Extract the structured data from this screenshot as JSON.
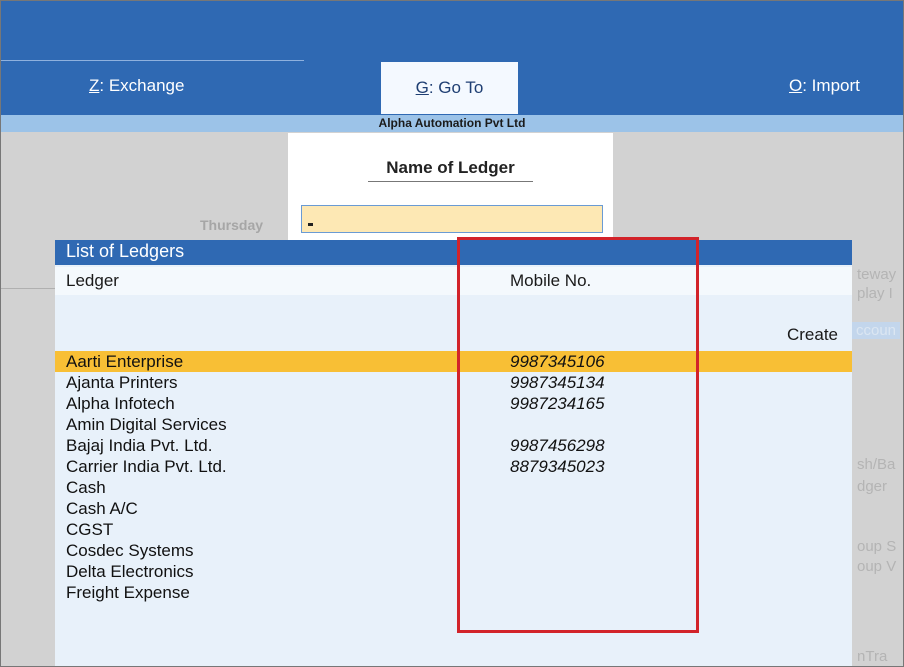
{
  "menu": {
    "exchange": {
      "key": "Z",
      "label": ": Exchange"
    },
    "goto": {
      "key": "G",
      "label": ": Go To"
    },
    "import": {
      "key": "O",
      "label": ": Import"
    }
  },
  "company": "Alpha Automation Pvt Ltd",
  "name_box": {
    "title": "Name of Ledger",
    "value": ""
  },
  "background": {
    "day": "Thursday",
    "ghost_right": [
      "teway",
      "play I",
      "ccoun",
      "sh/Ba",
      "dger",
      "oup S",
      "oup V",
      "nTra"
    ]
  },
  "list": {
    "title": "List of Ledgers",
    "columns": [
      "Ledger",
      "Mobile No."
    ],
    "create_label": "Create",
    "rows": [
      {
        "name": "Aarti Enterprise",
        "mobile": "9987345106",
        "selected": true
      },
      {
        "name": "Ajanta Printers",
        "mobile": "9987345134"
      },
      {
        "name": "Alpha Infotech",
        "mobile": "9987234165"
      },
      {
        "name": "Amin Digital Services",
        "mobile": ""
      },
      {
        "name": "Bajaj India Pvt. Ltd.",
        "mobile": "9987456298"
      },
      {
        "name": "Carrier India Pvt. Ltd.",
        "mobile": "8879345023"
      },
      {
        "name": "Cash",
        "mobile": ""
      },
      {
        "name": "Cash A/C",
        "mobile": ""
      },
      {
        "name": "CGST",
        "mobile": ""
      },
      {
        "name": "Cosdec Systems",
        "mobile": ""
      },
      {
        "name": "Delta Electronics",
        "mobile": ""
      },
      {
        "name": "Freight Expense",
        "mobile": ""
      }
    ]
  },
  "colors": {
    "topbar": "#2f69b3",
    "selection": "#f8bf35",
    "highlight": "#d2232a",
    "company_bar": "#9cc3e8"
  }
}
